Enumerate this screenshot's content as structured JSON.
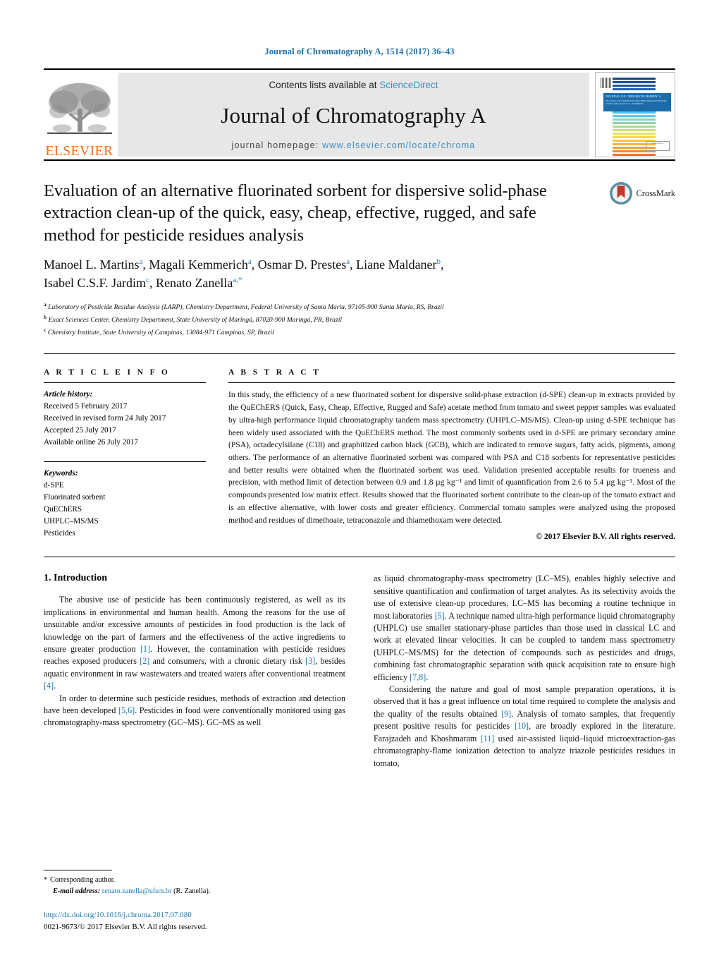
{
  "running_head": "Journal of Chromatography A, 1514 (2017) 36–43",
  "masthead": {
    "contents_prefix": "Contents lists available at ",
    "sciencedirect": "ScienceDirect",
    "journal_name": "Journal of Chromatography A",
    "homepage_prefix": "journal homepage: ",
    "homepage_url": "www.elsevier.com/locate/chroma",
    "publisher": "ELSEVIER",
    "cover_title": "JOURNAL OF CHROMATOGRAPHY A",
    "cover_subtitle": "INCLUDING ELECTROPHORESIS AND OTHER SEPARATION METHODS AND RELATED ANALYTICAL TECHNIQUES",
    "cover_footer": "ScienceDirect\nwww.sciencedirect.com",
    "accent_link": "#3b8fc4"
  },
  "title": "Evaluation of an alternative fluorinated sorbent for dispersive solid-phase extraction clean-up of the quick, easy, cheap, effective, rugged, and safe method for pesticide residues analysis",
  "crossmark_label": "CrossMark",
  "authors_line_1": "Manoel L. Martins",
  "authors": [
    {
      "name": "Manoel L. Martins",
      "sup": "a"
    },
    {
      "name": "Magali Kemmerich",
      "sup": "a"
    },
    {
      "name": "Osmar D. Prestes",
      "sup": "a"
    },
    {
      "name": "Liane Maldaner",
      "sup": "b"
    },
    {
      "name": "Isabel C.S.F. Jardim",
      "sup": "c"
    },
    {
      "name": "Renato Zanella",
      "sup": "a,*"
    }
  ],
  "affiliations": [
    {
      "marker": "a",
      "text": "Laboratory of Pesticide Residue Analysis (LARP), Chemistry Department, Federal University of Santa Maria, 97105-900 Santa Maria, RS, Brazil"
    },
    {
      "marker": "b",
      "text": "Exact Sciences Center, Chemistry Department, State University of Maringá, 87020-900 Maringá, PR, Brazil"
    },
    {
      "marker": "c",
      "text": "Chemistry Institute, State University of Campinas, 13084-971 Campinas, SP, Brazil"
    }
  ],
  "article_info": {
    "heading": "A R T I C L E   I N F O",
    "history_label": "Article history:",
    "history": [
      "Received 5 February 2017",
      "Received in revised form 24 July 2017",
      "Accepted 25 July 2017",
      "Available online 26 July 2017"
    ],
    "keywords_label": "Keywords:",
    "keywords": [
      "d-SPE",
      "Fluorinated sorbent",
      "QuEChERS",
      "UHPLC–MS/MS",
      "Pesticides"
    ]
  },
  "abstract": {
    "heading": "A B S T R A C T",
    "text": "In this study, the efficiency of a new fluorinated sorbent for dispersive solid-phase extraction (d-SPE) clean-up in extracts provided by the QuEChERS (Quick, Easy, Cheap, Effective, Rugged and Safe) acetate method from tomato and sweet pepper samples was evaluated by ultra-high performance liquid chromatography tandem mass spectrometry (UHPLC–MS/MS). Clean-up using d-SPE technique has been widely used associated with the QuEChERS method. The most commonly sorbents used in d-SPE are primary secondary amine (PSA), octadecylsilane (C18) and graphitized carbon black (GCB), which are indicated to remove sugars, fatty acids, pigments, among others. The performance of an alternative fluorinated sorbent was compared with PSA and C18 sorbents for representative pesticides and better results were obtained when the fluorinated sorbent was used. Validation presented acceptable results for trueness and precision, with method limit of detection between 0.9 and 1.8 µg kg⁻¹ and limit of quantification from 2.6 to 5.4 µg kg⁻¹. Most of the compounds presented low matrix effect. Results showed that the fluorinated sorbent contribute to the clean-up of the tomato extract and is an effective alternative, with lower costs and greater efficiency. Commercial tomato samples were analyzed using the proposed method and residues of dimethoate, tetraconazole and thiamethoxam were detected.",
    "copyright": "© 2017 Elsevier B.V. All rights reserved."
  },
  "introduction": {
    "heading": "1.  Introduction",
    "left_paragraphs": [
      "The abusive use of pesticide has been continuously registered, as well as its implications in environmental and human health. Among the reasons for the use of unsuitable and/or excessive amounts of pesticides in food production is the lack of knowledge on the part of farmers and the effectiveness of the active ingredients to ensure greater production [1]. However, the contamination with pesticide residues reaches exposed producers [2] and consumers, with a chronic dietary risk [3], besides aquatic environment in raw wastewaters and treated waters after conventional treatment [4].",
      "In order to determine such pesticide residues, methods of extraction and detection have been developed [5,6]. Pesticides in food were conventionally monitored using gas chromatography-mass spectrometry (GC–MS). GC–MS as well"
    ],
    "right_paragraphs": [
      "as liquid chromatography-mass spectrometry (LC–MS), enables highly selective and sensitive quantification and confirmation of target analytes. As its selectivity avoids the use of extensive clean-up procedures, LC–MS has becoming a routine technique in most laboratories [5]. A technique named ultra-high performance liquid chromatography (UHPLC) use smaller stationary-phase particles than those used in classical LC and work at elevated linear velocities. It can be coupled to tandem mass spectrometry (UHPLC–MS/MS) for the detection of compounds such as pesticides and drugs, combining fast chromatographic separation with quick acquisition rate to ensure high efficiency [7,8].",
      "Considering the nature and goal of most sample preparation operations, it is observed that it has a great influence on total time required to complete the analysis and the quality of the results obtained [9]. Analysis of tomato samples, that frequently present positive results for pesticides [10], are broadly explored in the literature. Farajzadeh and Khoshmaram [11] used air-assisted liquid–liquid microextraction-gas chromatography-flame ionization detection to analyze triazole pesticides residues in tomato,"
    ]
  },
  "footnote": {
    "star": "*",
    "corresponding": "Corresponding author.",
    "email_label": "E-mail address:",
    "email": "renato.zanella@ufsm.br",
    "email_suffix": "(R. Zanella)."
  },
  "doi": "http://dx.doi.org/10.1016/j.chroma.2017.07.080",
  "issn_line": "0021-9673/© 2017 Elsevier B.V. All rights reserved."
}
